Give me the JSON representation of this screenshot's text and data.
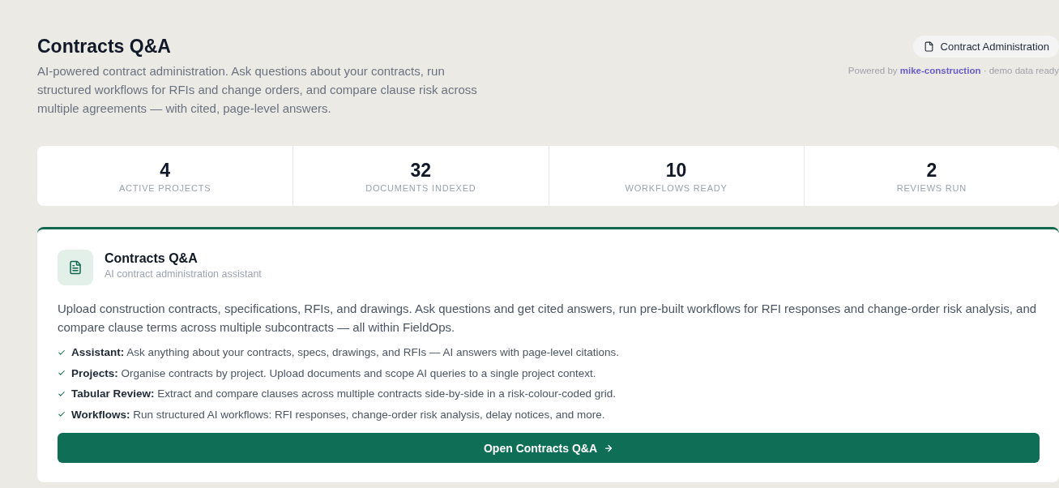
{
  "header": {
    "title": "Contracts Q&A",
    "description": "AI-powered contract administration. Ask questions about your contracts, run structured workflows for RFIs and change orders, and compare clause risk across multiple agreements — with cited, page-level answers.",
    "badge": "Contract Administration",
    "powered_by": {
      "prefix": "Powered by",
      "link": "mike-construction",
      "suffix": "· demo data ready"
    }
  },
  "stats": [
    {
      "value": "4",
      "label": "ACTIVE PROJECTS"
    },
    {
      "value": "32",
      "label": "DOCUMENTS INDEXED"
    },
    {
      "value": "10",
      "label": "WORKFLOWS READY"
    },
    {
      "value": "2",
      "label": "REVIEWS RUN"
    }
  ],
  "card": {
    "title": "Contracts Q&A",
    "subtitle": "AI contract administration assistant",
    "description": "Upload construction contracts, specifications, RFIs, and drawings. Ask questions and get cited answers, run pre-built workflows for RFI responses and change-order risk analysis, and compare clause terms across multiple subcontracts — all within FieldOps.",
    "features": [
      "**Assistant:** Ask anything about your contracts, specs, drawings, and RFIs — AI answers with page-level citations.",
      "**Projects:** Organise contracts by project. Upload documents and scope AI queries to a single project context.",
      "**Tabular Review:** Extract and compare clauses across multiple contracts side-by-side in a risk-colour-coded grid.",
      "**Workflows:** Run structured AI workflows: RFI responses, change-order risk analysis, delay notices, and more."
    ],
    "button": "Open Contracts Q&A"
  }
}
